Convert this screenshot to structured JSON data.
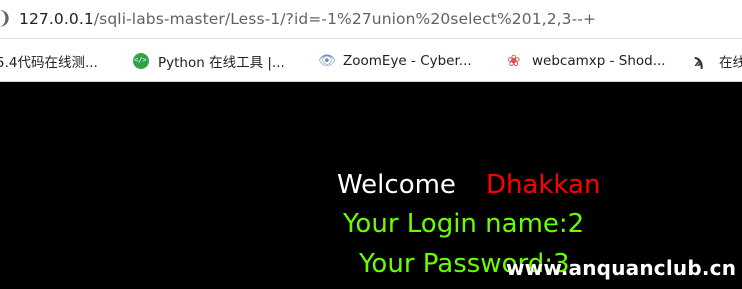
{
  "address_bar": {
    "url_host": "127.0.0.1",
    "url_path": "/sqli-labs-master/Less-1/?id=-1%27union%20select%201,2,3--+"
  },
  "bookmarks": [
    {
      "label": "5.4代码在线测...",
      "icon": "truncated-icon"
    },
    {
      "label": "Python 在线工具 |...",
      "icon": "python-code-icon"
    },
    {
      "label": "ZoomEye - Cyber...",
      "icon": "eye-icon"
    },
    {
      "label": "webcamxp - Shod...",
      "icon": "shodan-icon"
    },
    {
      "label": "在线",
      "icon": "fork-icon"
    }
  ],
  "page": {
    "welcome": "Welcome",
    "user": "Dhakkan",
    "login_name": "Your Login name:2",
    "password": "Your Password:3"
  },
  "watermark": "www.anquanclub.cn",
  "colors": {
    "background": "#000000",
    "welcome": "#ffffff",
    "user": "#ff0000",
    "result": "#66ff00"
  }
}
